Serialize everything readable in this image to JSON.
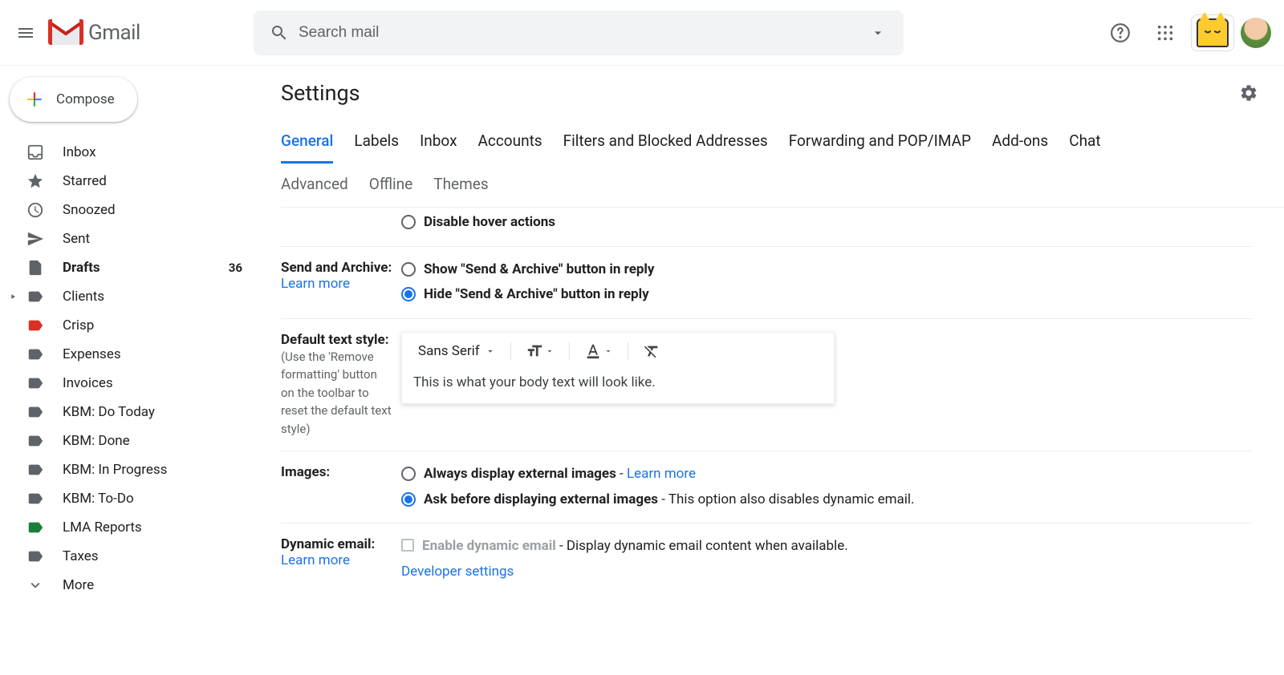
{
  "header": {
    "brand": "Gmail",
    "search_placeholder": "Search mail"
  },
  "compose_label": "Compose",
  "sidebar": [
    {
      "icon": "inbox",
      "label": "Inbox",
      "count": null,
      "bold": false
    },
    {
      "icon": "star",
      "label": "Starred",
      "count": null,
      "bold": false
    },
    {
      "icon": "clock",
      "label": "Snoozed",
      "count": null,
      "bold": false
    },
    {
      "icon": "send",
      "label": "Sent",
      "count": null,
      "bold": false
    },
    {
      "icon": "draft",
      "label": "Drafts",
      "count": "36",
      "bold": true
    },
    {
      "icon": "tag",
      "label": "Clients",
      "count": null,
      "bold": false,
      "expand": true
    },
    {
      "icon": "tag-red",
      "label": "Crisp",
      "count": null,
      "bold": false
    },
    {
      "icon": "tag",
      "label": "Expenses",
      "count": null,
      "bold": false
    },
    {
      "icon": "tag",
      "label": "Invoices",
      "count": null,
      "bold": false
    },
    {
      "icon": "tag",
      "label": "KBM: Do Today",
      "count": null,
      "bold": false
    },
    {
      "icon": "tag",
      "label": "KBM: Done",
      "count": null,
      "bold": false
    },
    {
      "icon": "tag",
      "label": "KBM: In Progress",
      "count": null,
      "bold": false
    },
    {
      "icon": "tag",
      "label": "KBM: To-Do",
      "count": null,
      "bold": false
    },
    {
      "icon": "tag-green",
      "label": "LMA Reports",
      "count": null,
      "bold": false
    },
    {
      "icon": "tag",
      "label": "Taxes",
      "count": null,
      "bold": false
    },
    {
      "icon": "more",
      "label": "More",
      "count": null,
      "bold": false
    }
  ],
  "main": {
    "title": "Settings",
    "tabs_row1": [
      "General",
      "Labels",
      "Inbox",
      "Accounts",
      "Filters and Blocked Addresses",
      "Forwarding and POP/IMAP",
      "Add-ons",
      "Chat"
    ],
    "tabs_row2": [
      "Advanced",
      "Offline",
      "Themes"
    ],
    "active_tab": "General",
    "hover_row": {
      "disable_label": "Disable hover actions"
    },
    "send_archive": {
      "title": "Send and Archive:",
      "learn_more": "Learn more",
      "show_label": "Show \"Send & Archive\" button in reply",
      "hide_label": "Hide \"Send & Archive\" button in reply"
    },
    "text_style": {
      "title": "Default text style:",
      "help": "(Use the 'Remove formatting' button on the toolbar to reset the default text style)",
      "font": "Sans Serif",
      "preview": "This is what your body text will look like."
    },
    "images": {
      "title": "Images:",
      "always_label": "Always display external images",
      "always_learn": "Learn more",
      "ask_label": "Ask before displaying external images",
      "ask_desc": "This option also disables dynamic email."
    },
    "dynamic": {
      "title": "Dynamic email:",
      "learn_more": "Learn more",
      "enable_label": "Enable dynamic email",
      "enable_desc": "Display dynamic email content when available.",
      "dev_settings": "Developer settings"
    }
  }
}
